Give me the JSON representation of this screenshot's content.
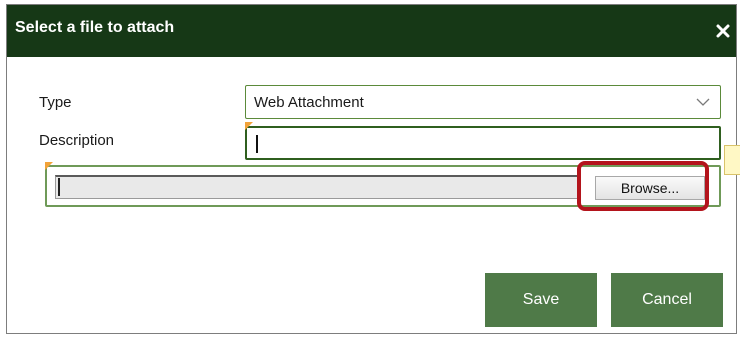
{
  "dialog": {
    "title": "Select a file to attach",
    "close_icon": "close-icon"
  },
  "form": {
    "type_label": "Type",
    "type_value": "Web Attachment",
    "description_label": "Description",
    "description_value": "",
    "file_path_value": "",
    "browse_label": "Browse..."
  },
  "actions": {
    "save_label": "Save",
    "cancel_label": "Cancel"
  },
  "colors": {
    "titlebar": "#163816",
    "button": "#4f7a48",
    "field_border": "#5b8a3a",
    "required_marker": "#f2a33a",
    "highlight": "#b3141c"
  }
}
